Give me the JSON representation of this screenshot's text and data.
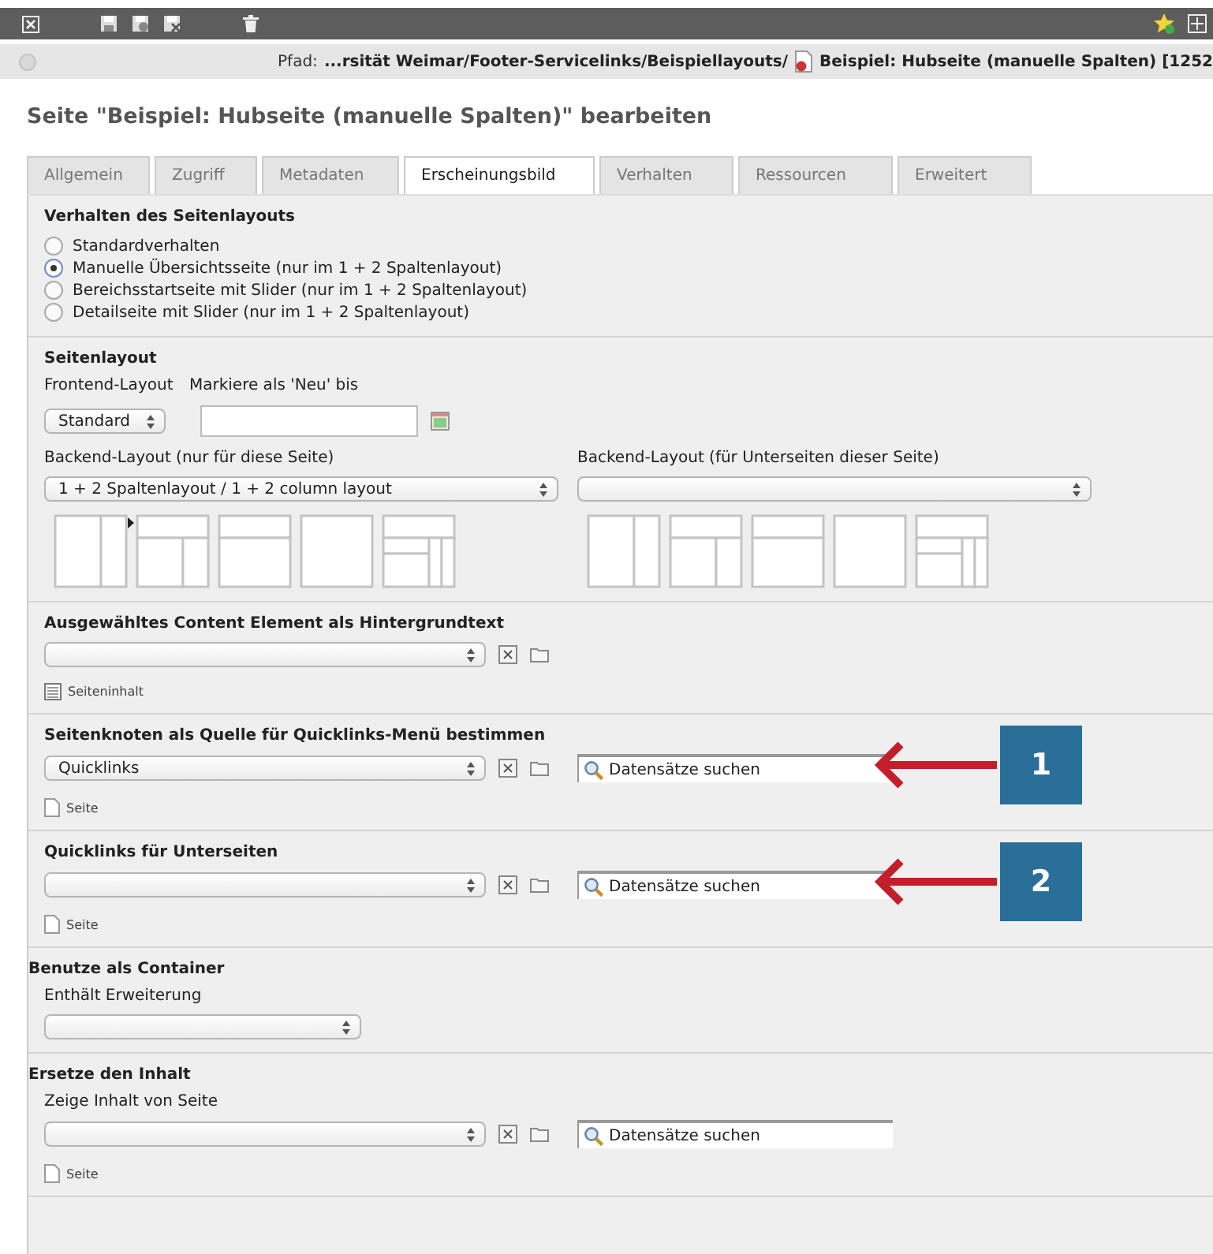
{
  "path": {
    "label": "Pfad:",
    "trail": "...rsität Weimar/Footer-Servicelinks/Beispiellayouts/",
    "page": "Beispiel: Hubseite (manuelle Spalten) [1252"
  },
  "title": "Seite \"Beispiel: Hubseite (manuelle Spalten)\" bearbeiten",
  "tabs": [
    {
      "label": "Allgemein",
      "selected": false
    },
    {
      "label": "Zugriff",
      "selected": false
    },
    {
      "label": "Metadaten",
      "selected": false
    },
    {
      "label": "Erscheinungsbild",
      "selected": true
    },
    {
      "label": "Verhalten",
      "selected": false
    },
    {
      "label": "Ressourcen",
      "selected": false
    },
    {
      "label": "Erweitert",
      "selected": false
    }
  ],
  "sections": [
    {
      "kind": "radios",
      "heading": "Verhalten des Seitenlayouts",
      "options": [
        {
          "label": "Standardverhalten",
          "selected": false
        },
        {
          "label": "Manuelle Übersichtsseite (nur im 1 + 2 Spaltenlayout)",
          "selected": true
        },
        {
          "label": "Bereichsstartseite mit Slider (nur im 1 + 2 Spaltenlayout)",
          "selected": false
        },
        {
          "label": "Detailseite mit Slider (nur im 1 + 2 Spaltenlayout)",
          "selected": false
        }
      ]
    },
    {
      "kind": "layout",
      "heading": "Seitenlayout",
      "frontend_label": "Frontend-Layout",
      "frontend_value": "Standard",
      "date_label": "Markiere als 'Neu' bis",
      "backends": [
        {
          "label": "Backend-Layout (nur für diese Seite)",
          "value": "1 + 2 Spaltenlayout / 1 + 2 column layout",
          "thumbnails": [
            {
              "kind": "sidebar",
              "selected": false
            },
            {
              "kind": "header_split",
              "selected": true
            },
            {
              "kind": "header",
              "selected": false
            },
            {
              "kind": "full",
              "selected": false
            },
            {
              "kind": "header_grid",
              "selected": false
            }
          ]
        },
        {
          "label": "Backend-Layout (für Unterseiten dieser Seite)",
          "thumbnails": [
            {
              "kind": "sidebar",
              "selected": false
            },
            {
              "kind": "header_split",
              "selected": false
            },
            {
              "kind": "header",
              "selected": false
            },
            {
              "kind": "full",
              "selected": false
            },
            {
              "kind": "header_grid",
              "selected": false
            }
          ]
        }
      ]
    },
    {
      "kind": "relation",
      "heading": "Ausgewähltes Content Element als Hintergrundtext",
      "record": {
        "kind": "content",
        "label": "Seiteninhalt"
      }
    },
    {
      "kind": "relation",
      "heading": "Seitenknoten als Quelle für Quicklinks-Menü bestimmen",
      "value": "Quicklinks",
      "search": {
        "placeholder": "Datensätze suchen"
      },
      "record": {
        "kind": "page",
        "label": "Seite"
      },
      "annotation": "1"
    },
    {
      "kind": "relation",
      "heading": "Quicklinks für Unterseiten",
      "search": {
        "placeholder": "Datensätze suchen"
      },
      "record": {
        "kind": "page",
        "label": "Seite"
      },
      "annotation": "2"
    },
    {
      "kind": "select",
      "heading": "Benutze als Container",
      "field_label": "Enthält Erweiterung"
    },
    {
      "kind": "relation",
      "heading": "Ersetze den Inhalt",
      "field_label": "Zeige Inhalt von Seite",
      "search": {
        "placeholder": "Datensätze suchen"
      },
      "record": {
        "kind": "page",
        "label": "Seite"
      }
    }
  ]
}
